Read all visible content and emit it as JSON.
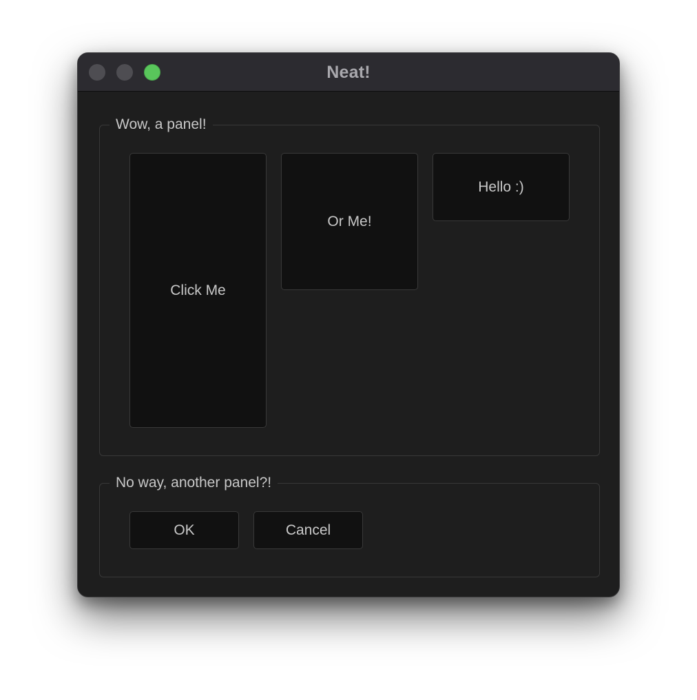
{
  "window": {
    "title": "Neat!",
    "traffic_lights": {
      "close_color": "#4e4d52",
      "minimize_color": "#4e4d52",
      "zoom_color": "#59c65b"
    }
  },
  "panel_1": {
    "legend": "Wow, a panel!",
    "buttons": {
      "click_me": "Click Me",
      "or_me": "Or Me!",
      "hello": "Hello :)"
    }
  },
  "panel_2": {
    "legend": "No way, another panel?!",
    "buttons": {
      "ok": "OK",
      "cancel": "Cancel"
    }
  },
  "colors": {
    "window_background": "#1e1e1e",
    "titlebar_background": "#2c2b30",
    "button_background": "#111111",
    "text": "#c9c9c9"
  }
}
